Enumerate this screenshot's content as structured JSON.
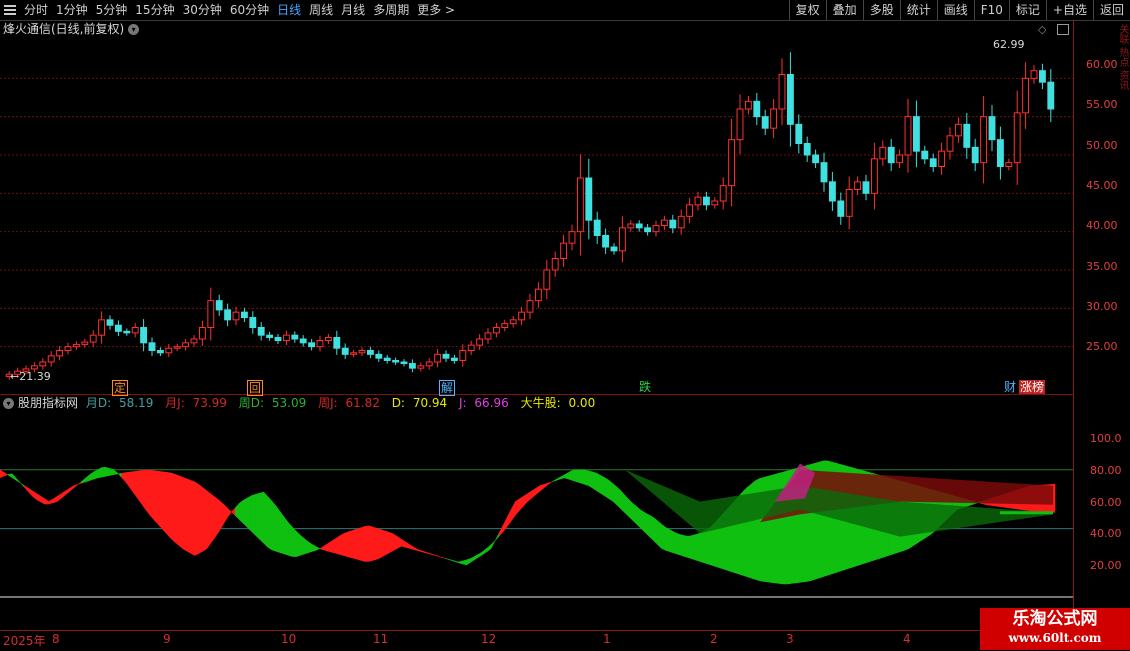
{
  "toolbar": {
    "periods": [
      "分时",
      "1分钟",
      "5分钟",
      "15分钟",
      "30分钟",
      "60分钟",
      "日线",
      "周线",
      "月线",
      "多周期",
      "更多 >"
    ],
    "active_period": "日线",
    "actions": [
      "复权",
      "叠加",
      "多股",
      "统计",
      "画线",
      "F10",
      "标记",
      "+自选",
      "返回"
    ]
  },
  "main_panel": {
    "title": "烽火通信(日线,前复权)",
    "high_marker": "62.99",
    "low_marker": "21.39",
    "price_ticks": [
      "60.00",
      "55.00",
      "50.00",
      "45.00",
      "40.00",
      "35.00",
      "30.00",
      "25.00"
    ],
    "events": [
      {
        "label": "定",
        "color": "#ff8c1a"
      },
      {
        "label": "回",
        "color": "#ff8c1a"
      },
      {
        "label": "解",
        "color": "#4fb6ff"
      },
      {
        "label": "跌",
        "color": "#2fd14a"
      },
      {
        "label": "财",
        "color": "#4fb6ff"
      },
      {
        "label": "涨榜",
        "color": "#ff4040"
      }
    ]
  },
  "indicator_panel": {
    "name": "股朋指标网",
    "values": [
      {
        "label": "月D:",
        "value": "58.19",
        "color": "#3fa0a0"
      },
      {
        "label": "月J:",
        "value": "73.99",
        "color": "#d02828"
      },
      {
        "label": "周D:",
        "value": "53.09",
        "color": "#2fb030"
      },
      {
        "label": "周J:",
        "value": "61.82",
        "color": "#d02828"
      },
      {
        "label": "D:",
        "value": "70.94",
        "color": "#e8e800"
      },
      {
        "label": "J:",
        "value": "66.96",
        "color": "#e040e0"
      },
      {
        "label": "大牛股:",
        "value": "0.00",
        "color": "#e8e800"
      }
    ],
    "ticks": [
      "100.0",
      "80.00",
      "60.00",
      "40.00",
      "20.00"
    ]
  },
  "date_axis": [
    "2025年",
    "8",
    "9",
    "10",
    "11",
    "12",
    "1",
    "2",
    "3",
    "4"
  ],
  "watermark": {
    "line1": "乐淘公式网",
    "line2": "www.60lt.com"
  },
  "side_text": "关联 热点 资讯",
  "chart_data": {
    "type": "candlestick",
    "title": "烽火通信(日线,前复权)",
    "ylim": [
      20,
      65
    ],
    "closes": [
      21.4,
      21.8,
      22.1,
      22.5,
      23.0,
      23.8,
      24.5,
      25.0,
      25.3,
      25.6,
      26.5,
      28.5,
      27.8,
      27.0,
      26.8,
      27.5,
      25.5,
      24.5,
      24.2,
      24.8,
      25.0,
      25.5,
      26.0,
      27.5,
      31.0,
      29.8,
      28.5,
      29.5,
      28.8,
      27.5,
      26.5,
      26.2,
      25.8,
      26.5,
      26.0,
      25.5,
      25.0,
      25.8,
      26.2,
      24.8,
      24.0,
      24.2,
      24.5,
      24.0,
      23.5,
      23.2,
      23.0,
      22.8,
      22.2,
      22.5,
      23.0,
      24.0,
      23.5,
      23.2,
      24.5,
      25.2,
      26.0,
      26.8,
      27.5,
      28.0,
      28.5,
      29.5,
      31.0,
      32.5,
      35.0,
      36.5,
      38.5,
      40.0,
      47.0,
      41.5,
      39.5,
      38.0,
      37.5,
      40.5,
      41.0,
      40.5,
      40.0,
      40.8,
      41.5,
      40.5,
      42.0,
      43.5,
      44.5,
      43.5,
      44.0,
      46.0,
      52.0,
      56.0,
      57.0,
      55.0,
      53.5,
      56.0,
      60.5,
      54.0,
      51.5,
      50.0,
      49.0,
      46.5,
      44.0,
      42.0,
      45.5,
      46.5,
      45.0,
      49.5,
      51.0,
      49.0,
      50.0,
      55.0,
      50.5,
      49.5,
      48.5,
      50.5,
      52.5,
      54.0,
      51.0,
      49.0,
      55.0,
      52.0,
      48.5,
      49.0,
      55.5,
      60.0,
      61.0,
      59.5,
      56.0
    ],
    "ind_week_d": [
      75,
      78,
      70,
      62,
      58,
      60,
      66,
      72,
      78,
      82,
      80,
      72,
      62,
      52,
      44,
      36,
      30,
      26,
      30,
      40,
      52,
      60,
      64,
      66,
      58,
      48,
      40,
      34,
      30,
      28,
      26,
      24,
      22,
      24,
      28,
      32,
      30,
      28,
      26,
      24,
      22,
      24,
      28,
      34,
      42,
      52,
      60,
      66,
      72,
      76,
      80,
      80,
      78,
      74,
      68,
      60,
      54,
      50,
      44,
      40,
      38,
      40,
      44,
      52,
      60,
      68,
      74,
      76,
      78,
      80,
      82,
      84,
      86,
      84,
      82,
      80,
      78,
      76,
      74,
      72,
      70,
      68,
      66,
      64,
      62,
      60,
      58,
      57,
      56,
      55,
      54,
      54,
      53.09
    ],
    "ind_d": [
      80,
      70,
      60,
      70,
      75,
      78,
      80,
      78,
      72,
      60,
      45,
      30,
      25,
      30,
      40,
      45,
      40,
      30,
      25,
      20,
      30,
      60,
      70,
      75,
      70,
      60,
      45,
      30,
      25,
      20,
      15,
      10,
      8,
      10,
      15,
      20,
      25,
      30,
      40,
      55,
      60,
      65,
      70,
      70.94
    ]
  }
}
